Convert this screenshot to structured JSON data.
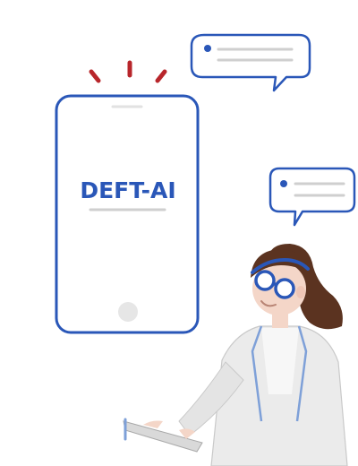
{
  "phone": {
    "brand_label": "DEFT-AI",
    "icon": "smartphone-icon"
  },
  "notification": {
    "icon": "alert-rays-icon"
  },
  "bubbles": [
    {
      "icon": "chat-bubble-icon"
    },
    {
      "icon": "chat-bubble-icon"
    }
  ],
  "character": {
    "icon": "doctor-with-clipboard-icon"
  },
  "colors": {
    "primary_blue": "#2a57b8",
    "alert_red": "#b8262b",
    "hair_brown": "#5b3320",
    "coat_gray": "#e8e8e8",
    "skin": "#f4d6c8",
    "line_gray": "#cfcfcf"
  }
}
